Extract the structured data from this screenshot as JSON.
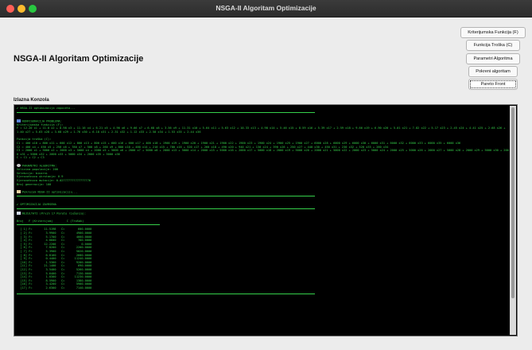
{
  "window": {
    "title": "NSGA-II Algoritam Optimizacije"
  },
  "app": {
    "title": "NSGA-II Algoritam Optimizacije"
  },
  "buttons": [
    {
      "label": "Kriterijumska Funkcija (F)"
    },
    {
      "label": "Funkcija Troška (C)"
    },
    {
      "label": "Parametri Algoritma"
    },
    {
      "label": "Pokreni algoritam"
    },
    {
      "label": "Pareto Front"
    }
  ],
  "console": {
    "label": "Izlazna Konzola",
    "start_msg": "✔ NSGA-II optimizacija zapoceta...",
    "config_header": "KONFIGURACIJA PROBLEMA:",
    "criterion_label": "Kriterijumska funkcija (F):",
    "criterion_text": "F = 12.20 x1 + 11.8 x2 + 8.98 x3 + 11.16 x4 + 6.21 x5 + 4.90 x6 + 9.66 x7 + 6.68 x8 + 3.56 x9 + 11.31 x10 + 5.64 x11 + 5.63 x12 + 10.33 x13 + 4.98 x14 + 5.46 x15 + 8.59 x16 + 5.39 x17 + 2.59 x18 + 9.66 x19 + 6.90 x20 + 5.01 x21 + 7.82 x22 + 5.17 x23 + 2.45 x24 + 4.41 x25 + 2.68 x26 + 1.40 x27 + 5.63 x28 + 3.68 x29 + 1.76 x30 + 6.18 x31 + 2.31 x32 + 1.12 x33 + 2.58 x34 + 1.53 x35 + 2.44 x36",
    "cost_label": "Funkcija troška (C):",
    "cost_lines": [
      "C1 = 400 x10 + 800 x11 + 600 x12 + 800 x13 + 800 x15 + 600 x16 + 600 x17 + 400 x18 + 1900 x19 + 1900 x20 + 1900 x21 + 1900 x22 + 1900 x23 + 1900 x24 + 1900 x25 + 1900 x27 + 6000 x28 + 6000 x29 + 6000 x30 + 6000 x31 + 6000 x32 + 6000 x33 + 6000 x35 + 6000 x36",
      "C2 = 400 x4 + 450 x5 + 250 x6 + 780 x7 + 500 x8 + 260 x9 + 880 x10 + 460 x14 + 210 x15 + 780 x16 + 520 x17 + 260 x18 + 490 x20 + 940 x21 + 130 x24 + 390 x26 + 250 x27 + 440 x30 + 450 x31 + 230 x32 + 520 x33 + 260 x34",
      "C3 = 2000 x1 + 5000 x2 + 2000 x3 + 5000 x4 + 2000 x5 + 5000 x6 + 2000 x7 + 5000 x8 + 2000 x13 + 5000 x14 + 2000 x15 + 5000 x16 + 2000 x17 + 5000 x18 + 2000 x19 + 5000 x20 + 2000 x21 + 5000 x22 + 2000 x23 + 5000 x24 + 2000 x25 + 5000 x26 + 2000 x27 + 5000 x28 + 2000 x29 + 5000 x30 + 2000 x31 + 5000 x32 + 2000 x33 + 5000 x34 + 2000 x35 + 5000 x36",
      "C = C1 + C2 + C3"
    ],
    "params_header": "PARAMETRI ALGORITMA:",
    "params": [
      "Velicina populacije: 200",
      "Selekcija: binarni",
      "Vjerovatnoca ukrstanja: 0.9",
      "Vjerovatnoca mutacije: 0.027777777777777776",
      "Broj generacija: 100"
    ],
    "run_msg": "Pokrecem NSGA-II optimizaciju...",
    "done_msg": "✔ OPTIMIZACIJA ZAVRSENA",
    "results_header": "REZULTATI (Prvih 17 Pareto rješenja):",
    "table_header": {
      "col1": "Broj",
      "col2": "F (Kriterijum)",
      "col3": "C (Trošak)"
    },
    "rows": [
      {
        "n": "1",
        "f": "11.5198",
        "c": "600.0000"
      },
      {
        "n": "2",
        "f": "3.9900",
        "c": "4900.0000"
      },
      {
        "n": "3",
        "f": "5.1700",
        "c": "4660.0000"
      },
      {
        "n": "4",
        "f": "4.6600",
        "c": "780.0000"
      },
      {
        "n": "5",
        "f": "12.2200",
        "c": "0.0000"
      },
      {
        "n": "6",
        "f": "7.8200",
        "c": "2200.0000"
      },
      {
        "n": "7",
        "f": "5.3900",
        "c": "5020.0000"
      },
      {
        "n": "8",
        "f": "6.8100",
        "c": "2680.0000"
      },
      {
        "n": "9",
        "f": "0.4400",
        "c": "11240.0000"
      },
      {
        "n": "10",
        "f": "1.5300",
        "c": "9200.0000"
      },
      {
        "n": "11",
        "f": "21.1400",
        "c": "690.0000"
      },
      {
        "n": "12",
        "f": "3.5400",
        "c": "5260.0000"
      },
      {
        "n": "13",
        "f": "5.6400",
        "c": "7130.0000"
      },
      {
        "n": "14",
        "f": "1.0300",
        "c": "11230.0000"
      },
      {
        "n": "15",
        "f": "8.5900",
        "c": "1380.0000"
      },
      {
        "n": "16",
        "f": "3.4200",
        "c": "5900.0000"
      },
      {
        "n": "17",
        "f": "2.6300",
        "c": "7140.0000"
      }
    ]
  },
  "colors": {
    "console_bg": "#000000",
    "console_text": "#35d04a",
    "window_bg": "#ececec"
  }
}
